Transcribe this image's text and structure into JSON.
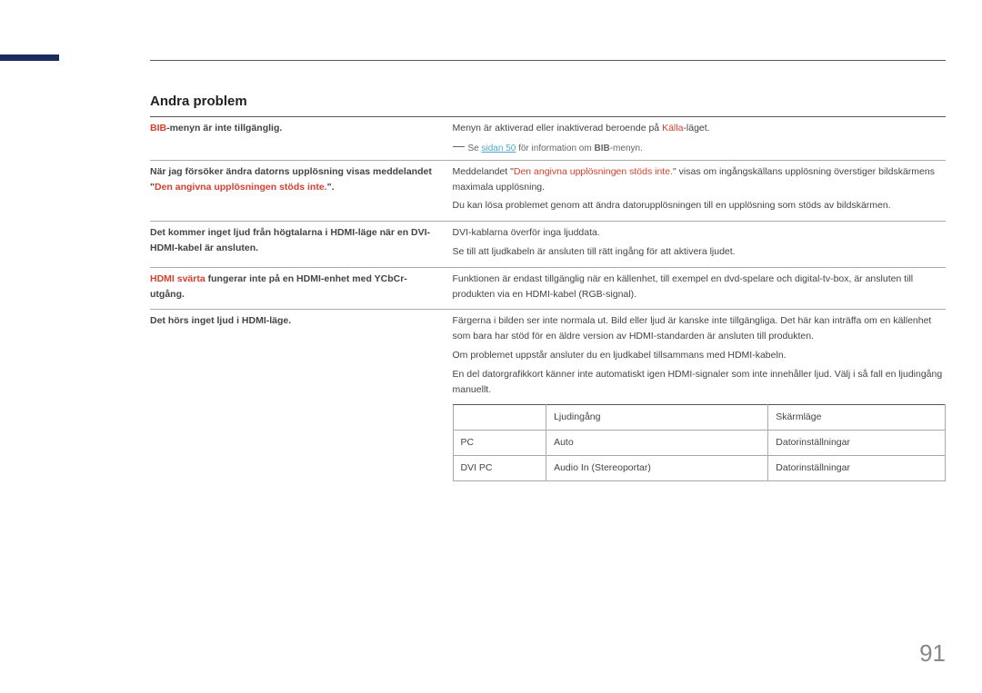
{
  "section_title": "Andra problem",
  "page_number": "91",
  "rows": [
    {
      "left": [
        {
          "text": "BIB",
          "red": true
        },
        {
          "text": "-menyn är inte tillgänglig.",
          "red": false
        }
      ],
      "right_paras": [
        [
          {
            "text": "Menyn är aktiverad eller inaktiverad beroende på "
          },
          {
            "text": "Källa",
            "red": true
          },
          {
            "text": "-läget."
          }
        ]
      ],
      "note": {
        "prefix": "Se ",
        "link": "sidan 50",
        "suffix": " för information om ",
        "bold": "BIB",
        "tail": "-menyn."
      }
    },
    {
      "left": [
        {
          "text": "När jag försöker ändra datorns upplösning visas meddelandet \""
        },
        {
          "text": "Den angivna upplösningen stöds inte.",
          "red": true
        },
        {
          "text": "\"."
        }
      ],
      "right_paras": [
        [
          {
            "text": "Meddelandet \""
          },
          {
            "text": "Den angivna upplösningen stöds inte.",
            "red": true
          },
          {
            "text": "\" visas om ingångskällans upplösning överstiger bildskärmens maximala upplösning."
          }
        ],
        [
          {
            "text": "Du kan lösa problemet genom att ändra datorupplösningen till en upplösning som stöds av bildskärmen."
          }
        ]
      ]
    },
    {
      "left": [
        {
          "text": "Det kommer inget ljud från högtalarna i HDMI-läge när en DVI-HDMI-kabel är ansluten."
        }
      ],
      "right_paras": [
        [
          {
            "text": "DVI-kablarna överför inga ljuddata."
          }
        ],
        [
          {
            "text": "Se till att ljudkabeln är ansluten till rätt ingång för att aktivera ljudet."
          }
        ]
      ]
    },
    {
      "left": [
        {
          "text": "HDMI svärta",
          "red": true
        },
        {
          "text": " fungerar inte på en HDMI-enhet med YCbCr-utgång."
        }
      ],
      "right_paras": [
        [
          {
            "text": "Funktionen är endast tillgänglig när en källenhet, till exempel en dvd-spelare och digital-tv-box, är ansluten till produkten via en HDMI-kabel (RGB-signal)."
          }
        ]
      ]
    },
    {
      "left": [
        {
          "text": "Det hörs inget ljud i HDMI-läge."
        }
      ],
      "right_paras": [
        [
          {
            "text": "Färgerna i bilden ser inte normala ut. Bild eller ljud är kanske inte tillgängliga. Det här kan inträffa om en källenhet som bara har stöd för en äldre version av HDMI-standarden är ansluten till produkten."
          }
        ],
        [
          {
            "text": "Om problemet uppstår ansluter du en ljudkabel tillsammans med HDMI-kabeln."
          }
        ],
        [
          {
            "text": "En del datorgrafikkort känner inte automatiskt igen HDMI-signaler som inte innehåller ljud. Välj i så fall en ljudingång manuellt."
          }
        ]
      ],
      "table": {
        "header": [
          "",
          "Ljudingång",
          "Skärmläge"
        ],
        "rows": [
          [
            "PC",
            "Auto",
            "Datorinställningar"
          ],
          [
            "DVI PC",
            "Audio In (Stereoportar)",
            "Datorinställningar"
          ]
        ]
      }
    }
  ]
}
